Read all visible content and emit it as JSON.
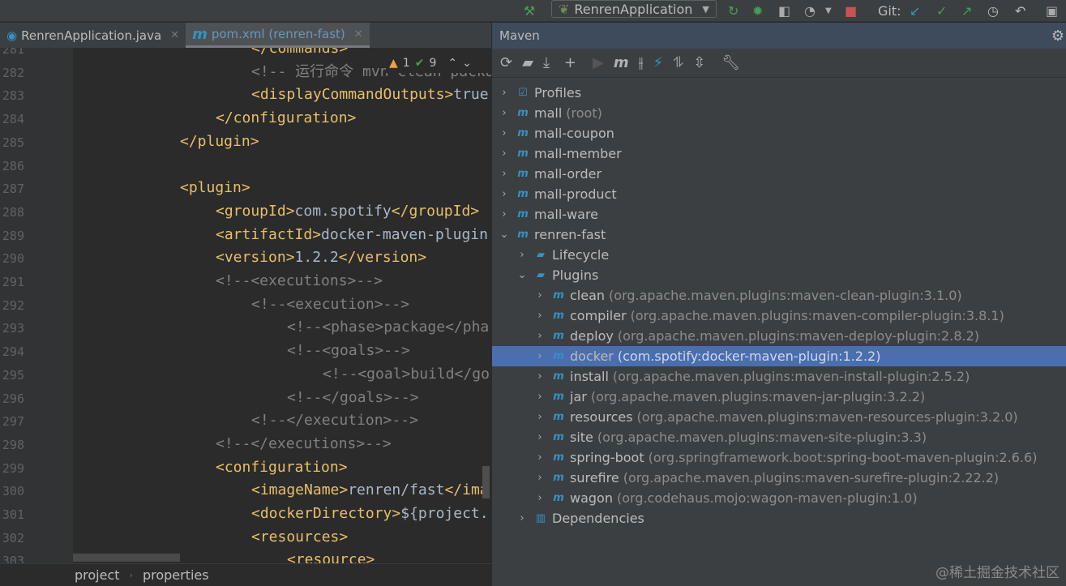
{
  "toolbar": {
    "run_config": "RenrenApplication",
    "git_label": "Git:",
    "colors": {
      "green": "#499c54",
      "red": "#c75450",
      "blue": "#3592c4"
    }
  },
  "tabs": [
    {
      "label": "RenrenApplication.java",
      "icon": "spring-boot-class-icon",
      "active": false
    },
    {
      "label": "pom.xml (renren-fast)",
      "icon": "maven-m-icon",
      "active": true
    }
  ],
  "inspections": {
    "warnings": "1",
    "ok": "9"
  },
  "editor": {
    "lines": [
      {
        "n": "281",
        "indent": 20,
        "parts": [
          [
            "tag",
            "</commands>"
          ]
        ]
      },
      {
        "n": "282",
        "indent": 20,
        "parts": [
          [
            "cmt",
            "<!-- 运行命令 mvn clean package"
          ]
        ]
      },
      {
        "n": "283",
        "indent": 20,
        "parts": [
          [
            "tag",
            "<displayCommandOutputs>"
          ],
          [
            "txt",
            "true"
          ]
        ]
      },
      {
        "n": "284",
        "indent": 16,
        "parts": [
          [
            "tag",
            "</configuration>"
          ]
        ]
      },
      {
        "n": "285",
        "indent": 12,
        "parts": [
          [
            "tag",
            "</plugin>"
          ]
        ]
      },
      {
        "n": "286",
        "indent": 0,
        "parts": []
      },
      {
        "n": "287",
        "indent": 12,
        "parts": [
          [
            "tag",
            "<plugin>"
          ]
        ]
      },
      {
        "n": "288",
        "indent": 16,
        "parts": [
          [
            "tag",
            "<groupId>"
          ],
          [
            "txt",
            "com.spotify"
          ],
          [
            "tag",
            "</groupId>"
          ]
        ]
      },
      {
        "n": "289",
        "indent": 16,
        "parts": [
          [
            "tag",
            "<artifactId>"
          ],
          [
            "txt",
            "docker-maven-plugin"
          ]
        ]
      },
      {
        "n": "290",
        "indent": 16,
        "parts": [
          [
            "tag",
            "<version>"
          ],
          [
            "txt",
            "1.2.2"
          ],
          [
            "tag",
            "</version>"
          ]
        ]
      },
      {
        "n": "291",
        "indent": 16,
        "parts": [
          [
            "cmt",
            "<!--<executions>-->"
          ]
        ]
      },
      {
        "n": "292",
        "indent": 20,
        "parts": [
          [
            "cmt",
            "<!--<execution>-->"
          ]
        ]
      },
      {
        "n": "293",
        "indent": 24,
        "parts": [
          [
            "cmt",
            "<!--<phase>package</pha"
          ]
        ]
      },
      {
        "n": "294",
        "indent": 24,
        "parts": [
          [
            "cmt",
            "<!--<goals>-->"
          ]
        ]
      },
      {
        "n": "295",
        "indent": 28,
        "parts": [
          [
            "cmt",
            "<!--<goal>build</go"
          ]
        ]
      },
      {
        "n": "296",
        "indent": 24,
        "parts": [
          [
            "cmt",
            "<!--</goals>-->"
          ]
        ]
      },
      {
        "n": "297",
        "indent": 20,
        "parts": [
          [
            "cmt",
            "<!--</execution>-->"
          ]
        ]
      },
      {
        "n": "298",
        "indent": 16,
        "parts": [
          [
            "cmt",
            "<!--</executions>-->"
          ]
        ]
      },
      {
        "n": "299",
        "indent": 16,
        "parts": [
          [
            "tag",
            "<configuration>"
          ]
        ]
      },
      {
        "n": "300",
        "indent": 20,
        "parts": [
          [
            "tag",
            "<imageName>"
          ],
          [
            "txt",
            "renren/fast"
          ],
          [
            "tag",
            "</ima"
          ]
        ]
      },
      {
        "n": "301",
        "indent": 20,
        "parts": [
          [
            "tag",
            "<dockerDirectory>"
          ],
          [
            "txt",
            "${project."
          ]
        ]
      },
      {
        "n": "302",
        "indent": 20,
        "parts": [
          [
            "tag",
            "<resources>"
          ]
        ]
      },
      {
        "n": "303",
        "indent": 24,
        "parts": [
          [
            "tag",
            "<resource>"
          ]
        ]
      }
    ]
  },
  "breadcrumb": [
    "project",
    "properties"
  ],
  "maven": {
    "title": "Maven",
    "tree": [
      {
        "level": 0,
        "label": "Profiles",
        "sub": "",
        "icon": "profiles-icon",
        "expanded": false
      },
      {
        "level": 0,
        "label": "mall",
        "sub": "(root)",
        "icon": "maven-module-icon",
        "expanded": false
      },
      {
        "level": 0,
        "label": "mall-coupon",
        "sub": "",
        "icon": "maven-module-icon",
        "expanded": false
      },
      {
        "level": 0,
        "label": "mall-member",
        "sub": "",
        "icon": "maven-module-icon",
        "expanded": false
      },
      {
        "level": 0,
        "label": "mall-order",
        "sub": "",
        "icon": "maven-module-icon",
        "expanded": false
      },
      {
        "level": 0,
        "label": "mall-product",
        "sub": "",
        "icon": "maven-module-icon",
        "expanded": false
      },
      {
        "level": 0,
        "label": "mall-ware",
        "sub": "",
        "icon": "maven-module-icon",
        "expanded": false
      },
      {
        "level": 0,
        "label": "renren-fast",
        "sub": "",
        "icon": "maven-module-icon",
        "expanded": true
      },
      {
        "level": 1,
        "label": "Lifecycle",
        "sub": "",
        "icon": "lifecycle-folder-icon",
        "expanded": false
      },
      {
        "level": 1,
        "label": "Plugins",
        "sub": "",
        "icon": "plugins-folder-icon",
        "expanded": true
      },
      {
        "level": 2,
        "label": "clean",
        "sub": "(org.apache.maven.plugins:maven-clean-plugin:3.1.0)",
        "icon": "maven-plugin-icon",
        "expanded": false
      },
      {
        "level": 2,
        "label": "compiler",
        "sub": "(org.apache.maven.plugins:maven-compiler-plugin:3.8.1)",
        "icon": "maven-plugin-icon",
        "expanded": false
      },
      {
        "level": 2,
        "label": "deploy",
        "sub": "(org.apache.maven.plugins:maven-deploy-plugin:2.8.2)",
        "icon": "maven-plugin-icon",
        "expanded": false
      },
      {
        "level": 2,
        "label": "docker",
        "sub": "(com.spotify:docker-maven-plugin:1.2.2)",
        "icon": "maven-plugin-icon",
        "expanded": false,
        "selected": true
      },
      {
        "level": 2,
        "label": "install",
        "sub": "(org.apache.maven.plugins:maven-install-plugin:2.5.2)",
        "icon": "maven-plugin-icon",
        "expanded": false
      },
      {
        "level": 2,
        "label": "jar",
        "sub": "(org.apache.maven.plugins:maven-jar-plugin:3.2.2)",
        "icon": "maven-plugin-icon",
        "expanded": false
      },
      {
        "level": 2,
        "label": "resources",
        "sub": "(org.apache.maven.plugins:maven-resources-plugin:3.2.0)",
        "icon": "maven-plugin-icon",
        "expanded": false
      },
      {
        "level": 2,
        "label": "site",
        "sub": "(org.apache.maven.plugins:maven-site-plugin:3.3)",
        "icon": "maven-plugin-icon",
        "expanded": false
      },
      {
        "level": 2,
        "label": "spring-boot",
        "sub": "(org.springframework.boot:spring-boot-maven-plugin:2.6.6)",
        "icon": "maven-plugin-icon",
        "expanded": false
      },
      {
        "level": 2,
        "label": "surefire",
        "sub": "(org.apache.maven.plugins:maven-surefire-plugin:2.22.2)",
        "icon": "maven-plugin-icon",
        "expanded": false
      },
      {
        "level": 2,
        "label": "wagon",
        "sub": "(org.codehaus.mojo:wagon-maven-plugin:1.0)",
        "icon": "maven-plugin-icon",
        "expanded": false
      },
      {
        "level": 1,
        "label": "Dependencies",
        "sub": "",
        "icon": "dependencies-folder-icon",
        "expanded": false
      }
    ]
  },
  "watermark": "@稀土掘金技术社区"
}
